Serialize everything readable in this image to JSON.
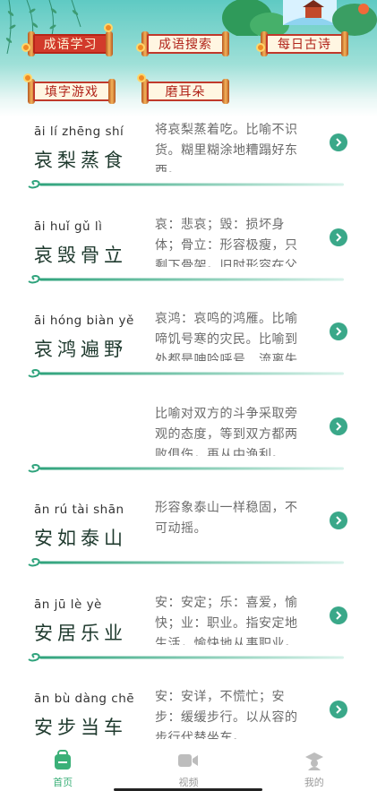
{
  "header": {
    "buttons": [
      {
        "label": "成语学习",
        "active": true
      },
      {
        "label": "成语搜索",
        "active": false
      },
      {
        "label": "每日古诗",
        "active": false
      },
      {
        "label": "填字游戏",
        "active": false
      },
      {
        "label": "磨耳朵",
        "active": false
      }
    ]
  },
  "idioms": [
    {
      "pinyin": "āi lí zhēng shí",
      "word": "哀梨蒸食",
      "desc": "将哀梨蒸着吃。比喻不识货。糊里糊涂地糟蹋好东西。"
    },
    {
      "pinyin": "āi huǐ gǔ lì",
      "word": "哀毁骨立",
      "desc": "哀：悲哀；毁：损坏身体；骨立：形容极瘦，只剩下骨架。旧时形容在父母丧中因过度悲伤而消瘦的样子。"
    },
    {
      "pinyin": "āi hóng biàn yě",
      "word": "哀鸿遍野",
      "desc": "哀鸿：哀鸣的鸿雁。比喻啼饥号寒的灾民。比喻到处都是呻吟呼号、流离失所的灾民。"
    },
    {
      "pinyin": "",
      "word": "",
      "desc": "比喻对双方的斗争采取旁观的态度，等到双方都两败俱伤，再从中渔利。"
    },
    {
      "pinyin": "ān rú tài shān",
      "word": "安如泰山",
      "desc": "形容象泰山一样稳固，不可动摇。"
    },
    {
      "pinyin": "ān jū lè yè",
      "word": "安居乐业",
      "desc": "安：安定；乐：喜爱，愉快；业：职业。指安定地生活，愉快地从事职业。"
    },
    {
      "pinyin": "ān bù dàng chē",
      "word": "安步当车",
      "desc": "安：安详，不慌忙；安步：缓缓步行。以从容的步行代替坐车。"
    }
  ],
  "tabbar": {
    "tabs": [
      {
        "label": "首页",
        "icon": "home-bag-icon",
        "active": true
      },
      {
        "label": "视频",
        "icon": "video-camera-icon",
        "active": false
      },
      {
        "label": "我的",
        "icon": "graduate-cap-icon",
        "active": false
      }
    ]
  },
  "colors": {
    "accent": "#3bb078",
    "chevron": "#3aa889",
    "header_teal": "#5fcac3",
    "scroll_red": "#d23a2b"
  }
}
